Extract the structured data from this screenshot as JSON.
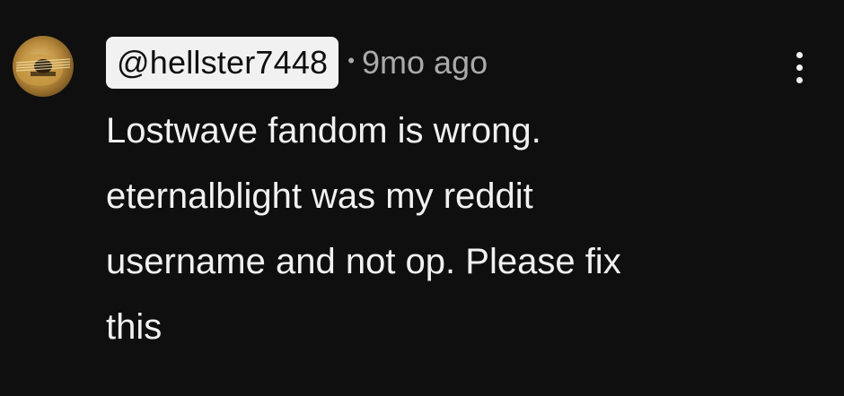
{
  "comment": {
    "avatar_icon": "guitar-avatar-icon",
    "author_handle": "@hellster7448",
    "separator": "•",
    "timestamp": "9mo ago",
    "menu_icon": "more-vertical-icon",
    "text": "Lostwave fandom is wrong.\neternalblight was my reddit\nusername and not op. Please fix\nthis"
  },
  "colors": {
    "background": "#0f0f0f",
    "text": "#f1f1f1",
    "meta_text": "#aaaaaa",
    "handle_chip_bg": "#f1f1f1",
    "handle_chip_text": "#0f0f0f"
  }
}
